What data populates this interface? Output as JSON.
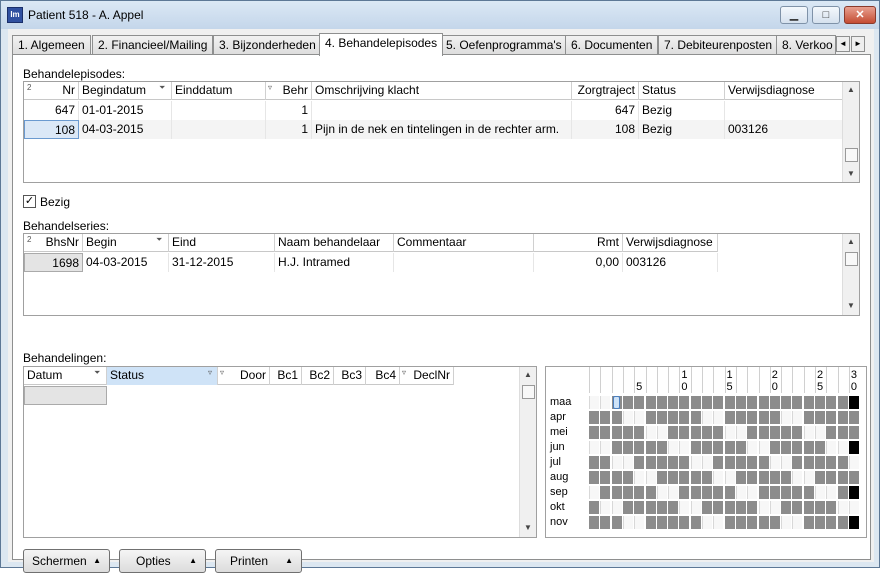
{
  "window": {
    "title": "Patient 518 - A. Appel",
    "icon_text": "Im"
  },
  "tabs": [
    "1. Algemeen",
    "2. Financieel/Mailing",
    "3. Bijzonderheden",
    "4. Behandelepisodes",
    "5. Oefenprogramma's",
    "6. Documenten",
    "7. Debiteurenposten",
    "8. Verkoo"
  ],
  "episodes": {
    "label": "Behandelepisodes:",
    "columns": [
      "Nr",
      "Begindatum",
      "Einddatum",
      "Behr",
      "Omschrijving klacht",
      "Zorgtraject",
      "Status",
      "Verwijsdiagnose"
    ],
    "rows": [
      {
        "nr": "647",
        "begin": "01-01-2015",
        "eind": "",
        "behr": "1",
        "omschrijving": "",
        "zorgtraject": "647",
        "status": "Bezig",
        "verwijs": ""
      },
      {
        "nr": "108",
        "begin": "04-03-2015",
        "eind": "",
        "behr": "1",
        "omschrijving": "Pijn in de nek en tintelingen in de rechter arm.",
        "zorgtraject": "108",
        "status": "Bezig",
        "verwijs": "003126"
      }
    ]
  },
  "bezig": {
    "label": "Bezig",
    "checked": true
  },
  "series": {
    "label": "Behandelseries:",
    "columns": [
      "BhsNr",
      "Begin",
      "Eind",
      "Naam behandelaar",
      "Commentaar",
      "Rmt",
      "Verwijsdiagnose"
    ],
    "rows": [
      {
        "bhsnr": "1698",
        "begin": "04-03-2015",
        "eind": "31-12-2015",
        "naam": "H.J. Intramed",
        "commentaar": "",
        "rmt": "0,00",
        "verwijs": "003126"
      }
    ]
  },
  "treatments": {
    "label": "Behandelingen:",
    "columns": [
      "Datum",
      "Status",
      "Door",
      "Bc1",
      "Bc2",
      "Bc3",
      "Bc4",
      "DeclNr"
    ]
  },
  "calendar": {
    "months": [
      "maa",
      "apr",
      "mei",
      "jun",
      "jul",
      "aug",
      "sep",
      "okt",
      "nov"
    ],
    "day_labels": [
      {
        "top": "",
        "bottom": "5"
      },
      {
        "top": "1",
        "bottom": "0"
      },
      {
        "top": "1",
        "bottom": "5"
      },
      {
        "top": "2",
        "bottom": "0"
      },
      {
        "top": "2",
        "bottom": "5"
      },
      {
        "top": "3",
        "bottom": "0"
      }
    ]
  },
  "buttons": {
    "schermen": "Schermen",
    "opties": "Opties",
    "printen": "Printen"
  },
  "glyphs": {
    "min": "▁",
    "max": "□",
    "close": "✕",
    "up": "▲",
    "down": "▼",
    "left": "◄",
    "right": "►",
    "check": "✓",
    "sort": "▿",
    "filter": "⏷"
  }
}
